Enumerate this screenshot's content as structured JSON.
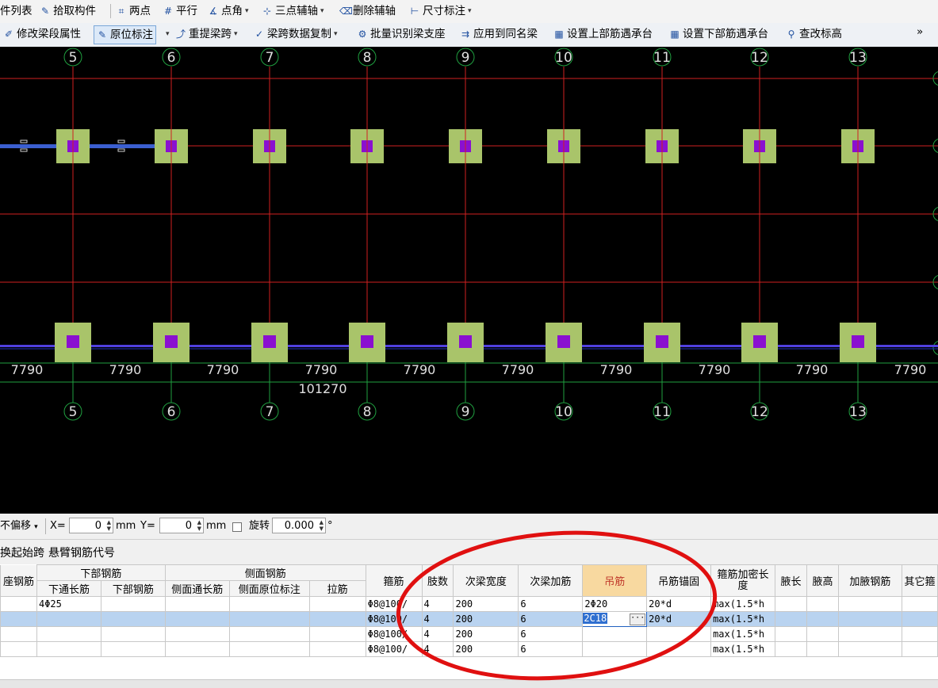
{
  "toolbar1": {
    "items": [
      {
        "label": "件列表",
        "icon": ""
      },
      {
        "label": "拾取构件",
        "icon": "pick-icon"
      },
      {
        "label": "两点",
        "icon": "two-point-axis-icon"
      },
      {
        "label": "平行",
        "icon": "parallel-axis-icon"
      },
      {
        "label": "点角",
        "icon": "point-angle-icon"
      },
      {
        "label": "三点辅轴",
        "icon": "three-point-axis-icon"
      },
      {
        "label": "删除辅轴",
        "icon": "delete-axis-icon"
      },
      {
        "label": "尺寸标注",
        "icon": "dimension-icon"
      }
    ]
  },
  "toolbar2": {
    "items": [
      {
        "label": "修改梁段属性",
        "icon": "edit-beam-icon"
      },
      {
        "label": "原位标注",
        "icon": "in-place-annotation-icon",
        "active": true
      },
      {
        "label": "重提梁跨",
        "icon": "re-extract-span-icon"
      },
      {
        "label": "梁跨数据复制",
        "icon": "copy-span-data-icon"
      },
      {
        "label": "批量识别梁支座",
        "icon": "batch-recognize-support-icon"
      },
      {
        "label": "应用到同名梁",
        "icon": "apply-same-name-icon"
      },
      {
        "label": "设置上部筋遇承台",
        "icon": "set-top-rebar-icon"
      },
      {
        "label": "设置下部筋遇承台",
        "icon": "set-bottom-rebar-icon"
      },
      {
        "label": "查改标高",
        "icon": "check-elevation-icon"
      }
    ],
    "more": "»"
  },
  "canvas": {
    "axis_numbers": [
      "5",
      "6",
      "7",
      "8",
      "9",
      "10",
      "11",
      "12",
      "13"
    ],
    "span_length": "7790",
    "total_length": "101270",
    "colors": {
      "background": "#000000",
      "grid_red": "#d02020",
      "grid_green": "#20a040",
      "column": "#a9c46a",
      "column_core": "#8a10d0",
      "beam": "#3b5fd0"
    }
  },
  "statusbar": {
    "offset_mode": "不偏移",
    "x_label": "X=",
    "x_value": "0",
    "unit": "mm",
    "y_label": "Y=",
    "y_value": "0",
    "rotate_label": "旋转",
    "rotate_value": "0.000",
    "degree": "°"
  },
  "tabs": [
    "换起始跨",
    "悬臂钢筋代号"
  ],
  "table": {
    "group_headers": {
      "bottom": "下部钢筋",
      "side": "侧面钢筋"
    },
    "columns": [
      "座钢筋",
      "下通长筋",
      "下部钢筋",
      "侧面通长筋",
      "侧面原位标注",
      "拉筋",
      "箍筋",
      "肢数",
      "次梁宽度",
      "次梁加筋",
      "吊筋",
      "吊筋锚固",
      "箍筋加密长度",
      "腋长",
      "腋高",
      "加腋钢筋",
      "其它箍"
    ],
    "rows": [
      [
        "",
        "4Φ25",
        "",
        "",
        "",
        "",
        "Φ8@100/",
        "4",
        "200",
        "6",
        "2Φ20",
        "20*d",
        "max(1.5*h",
        "",
        "",
        "",
        ""
      ],
      [
        "",
        "",
        "",
        "",
        "",
        "",
        "Φ8@100/",
        "4",
        "200",
        "6",
        "2C18",
        "20*d",
        "max(1.5*h",
        "",
        "",
        "",
        ""
      ],
      [
        "",
        "",
        "",
        "",
        "",
        "",
        "Φ8@100/",
        "4",
        "200",
        "6",
        "",
        "",
        "max(1.5*h",
        "",
        "",
        "",
        ""
      ],
      [
        "",
        "",
        "",
        "",
        "",
        "",
        "Φ8@100/",
        "4",
        "200",
        "6",
        "",
        "",
        "max(1.5*h",
        "",
        "",
        "",
        ""
      ]
    ],
    "selected_row": 1,
    "editing_value": "2C18",
    "edit_button": "···"
  }
}
